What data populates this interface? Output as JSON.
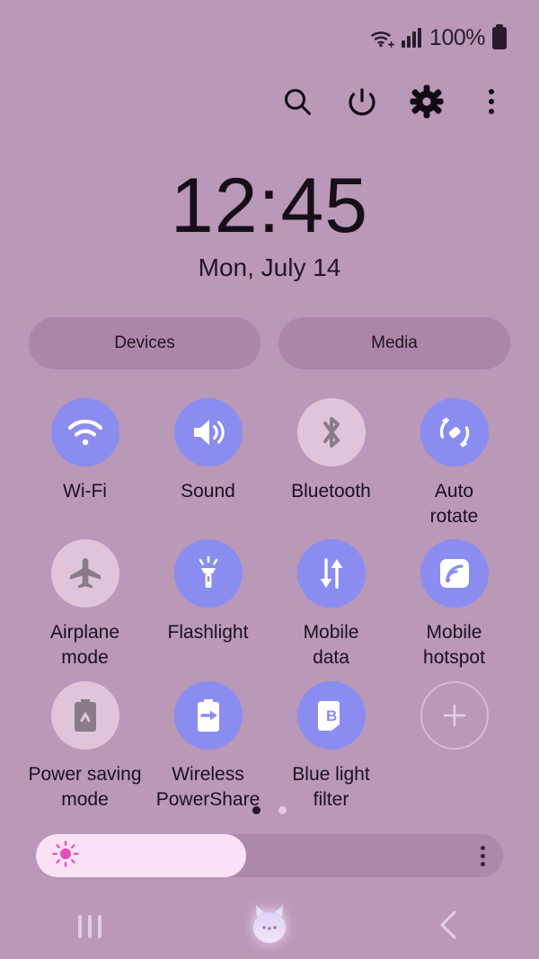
{
  "statusbar": {
    "wifi_icon": "wifi-icon",
    "signal_icon": "cellular-signal-icon",
    "battery_percent": "100%",
    "battery_icon": "battery-full-icon"
  },
  "header": {
    "icons": [
      {
        "name": "search-icon",
        "label": "Search"
      },
      {
        "name": "power-icon",
        "label": "Power"
      },
      {
        "name": "settings-gear-icon",
        "label": "Settings"
      },
      {
        "name": "more-options-icon",
        "label": "More options"
      }
    ]
  },
  "clock": {
    "time": "12:45",
    "date": "Mon, July 14"
  },
  "pills": [
    {
      "label": "Devices"
    },
    {
      "label": "Media"
    }
  ],
  "toggles": [
    {
      "label": "Wi-Fi",
      "icon": "wifi-icon",
      "state": "on"
    },
    {
      "label": "Sound",
      "icon": "sound-speaker-icon",
      "state": "on"
    },
    {
      "label": "Bluetooth",
      "icon": "bluetooth-icon",
      "state": "off"
    },
    {
      "label": "Auto\nrotate",
      "icon": "auto-rotate-icon",
      "state": "on"
    },
    {
      "label": "Airplane\nmode",
      "icon": "airplane-icon",
      "state": "off"
    },
    {
      "label": "Flashlight",
      "icon": "flashlight-icon",
      "state": "on"
    },
    {
      "label": "Mobile\ndata",
      "icon": "mobile-data-icon",
      "state": "on"
    },
    {
      "label": "Mobile\nhotspot",
      "icon": "hotspot-icon",
      "state": "on"
    },
    {
      "label": "Power saving\nmode",
      "icon": "power-saving-icon",
      "state": "off"
    },
    {
      "label": "Wireless\nPowerShare",
      "icon": "powershare-icon",
      "state": "on"
    },
    {
      "label": "Blue light\nfilter",
      "icon": "blue-light-filter-icon",
      "state": "on"
    },
    {
      "label": "",
      "icon": "add-plus-icon",
      "state": "add"
    }
  ],
  "pagination": {
    "total": 2,
    "active_index": 0
  },
  "brightness": {
    "icon": "brightness-sun-icon",
    "level_percent": 45,
    "menu_icon": "more-options-icon"
  },
  "navbar": {
    "recents_label": "Recents",
    "home_label": "Home",
    "back_label": "Back",
    "home_icon": "cat-home-icon"
  },
  "colors": {
    "background": "#b998b8",
    "toggle_on": "#8a8cf0",
    "toggle_off": "#dfc4da",
    "slider_fill": "#fbe1f5",
    "accent_sun": "#e050b8"
  }
}
